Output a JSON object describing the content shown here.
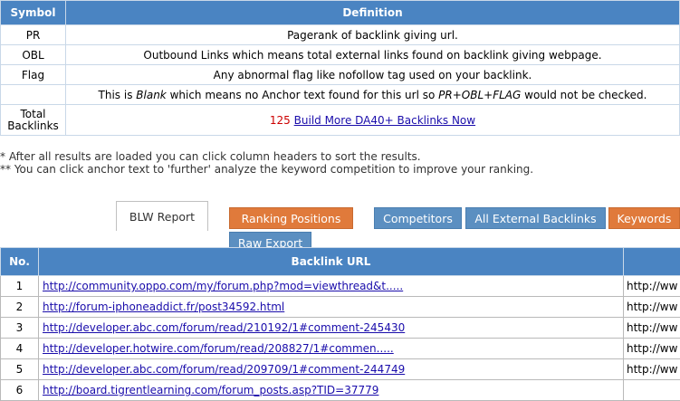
{
  "legend": {
    "headers": {
      "symbol": "Symbol",
      "definition": "Definition"
    },
    "rows": [
      {
        "symbol": "PR",
        "definition": "Pagerank of backlink giving url."
      },
      {
        "symbol": "OBL",
        "definition": "Outbound Links which means total external links found on backlink giving webpage."
      },
      {
        "symbol": "Flag",
        "definition": "Any abnormal flag like nofollow tag used on your backlink."
      }
    ],
    "blank_row": {
      "prefix": "This is ",
      "blank_word": "Blank",
      "middle": " which means no Anchor text found for this url so ",
      "flags": "PR+OBL+FLAG",
      "suffix": " would not be checked."
    },
    "total": {
      "label_line1": "Total",
      "label_line2": "Backlinks",
      "count": "125",
      "link_text": "Build More DA40+ Backlinks Now"
    }
  },
  "notes": {
    "line1": "* After all results are loaded you can click column headers to sort the results.",
    "line2": "** You can click anchor text to 'further' analyze the keyword competition to improve your ranking."
  },
  "tabs": {
    "blw_report": "BLW Report",
    "ranking_positions": "Ranking Positions",
    "competitors": "Competitors",
    "all_external_backlinks": "All External Backlinks",
    "keywords": "Keywords",
    "raw_export": "Raw Export"
  },
  "results": {
    "headers": {
      "no": "No.",
      "backlink_url": "Backlink URL"
    },
    "rows": [
      {
        "no": "1",
        "url": "http://community.oppo.com/my/forum.php?mod=viewthread&t.....",
        "ext": "http://ww"
      },
      {
        "no": "2",
        "url": "http://forum-iphoneaddict.fr/post34592.html",
        "ext": "http://ww"
      },
      {
        "no": "3",
        "url": "http://developer.abc.com/forum/read/210192/1#comment-245430",
        "ext": "http://ww"
      },
      {
        "no": "4",
        "url": "http://developer.hotwire.com/forum/read/208827/1#commen.....",
        "ext": "http://ww"
      },
      {
        "no": "5",
        "url": "http://developer.abc.com/forum/read/209709/1#comment-244749",
        "ext": "http://ww"
      },
      {
        "no": "6",
        "url": "http://board.tigrentlearning.com/forum_posts.asp?TID=37779",
        "ext": ""
      }
    ]
  },
  "colors": {
    "header_blue": "#4a84c2",
    "tab_orange": "#e07a3b",
    "tab_blue": "#5b8fc1",
    "link": "#1a0dab",
    "count_red": "#cc0000"
  }
}
